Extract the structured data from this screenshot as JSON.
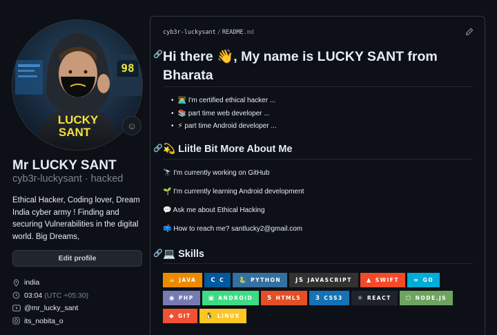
{
  "profile": {
    "full_name": "Mr LUCKY SANT",
    "username": "cyb3r-luckysant · hacked",
    "bio": "Ethical Hacker, Coding lover, Dream India cyber army ! Finding and securing Vulnerabilities in the digital world. Big Dreams,",
    "edit_label": "Edit profile",
    "avatar_text_line1": "LUCKY",
    "avatar_text_line2": "SANT",
    "avatar_number": "98",
    "location": "india",
    "time": "03:04",
    "timezone": "(UTC +05:30)",
    "youtube": "@mr_lucky_sant",
    "instagram": "its_nobita_o"
  },
  "readme": {
    "owner": "cyb3r-luckysant",
    "file_name": "README",
    "file_ext": ".md",
    "title": "Hi there 👋, My name is LUCKY SANT from Bharata",
    "bullets": [
      "👨‍💻 I'm certified ethical hacker ...",
      "📚 part time web developer ...",
      "⚡ part time Android developer ..."
    ],
    "about_heading": "💫 Liitle Bit More About Me",
    "about_items": [
      "🔭 I'm currently working on GitHub",
      "🌱 I'm currently learning Android development",
      "💬 Ask me about Ethical Hacking",
      "📫 How to reach me? santlucky2@gmail.com"
    ],
    "skills_heading": "💻 Skills",
    "badges_row1": [
      {
        "label": "JAVA",
        "icon": "☕",
        "color": "#ED8B00"
      },
      {
        "label": "C",
        "icon": "C",
        "color": "#00599C"
      },
      {
        "label": "PYTHON",
        "icon": "🐍",
        "color": "#3670A0"
      },
      {
        "label": "JAVASCRIPT",
        "icon": "JS",
        "color": "#323330"
      },
      {
        "label": "SWIFT",
        "icon": "▲",
        "color": "#F54A2A"
      },
      {
        "label": "GO",
        "icon": "∞",
        "color": "#00ADD8"
      }
    ],
    "badges_row2": [
      {
        "label": "PHP",
        "icon": "◉",
        "color": "#777BB4"
      },
      {
        "label": "ANDROID",
        "icon": "▣",
        "color": "#3DDC84"
      },
      {
        "label": "HTML5",
        "icon": "5",
        "color": "#E34F26"
      },
      {
        "label": "CSS3",
        "icon": "3",
        "color": "#1572B6"
      },
      {
        "label": "REACT",
        "icon": "⚛",
        "color": "#20232A"
      },
      {
        "label": "NODE.JS",
        "icon": "⬡",
        "color": "#6DA55F"
      }
    ],
    "badges_row3": [
      {
        "label": "GIT",
        "icon": "◆",
        "color": "#F05033"
      },
      {
        "label": "LINUX",
        "icon": "🐧",
        "color": "#FCC624"
      }
    ]
  }
}
